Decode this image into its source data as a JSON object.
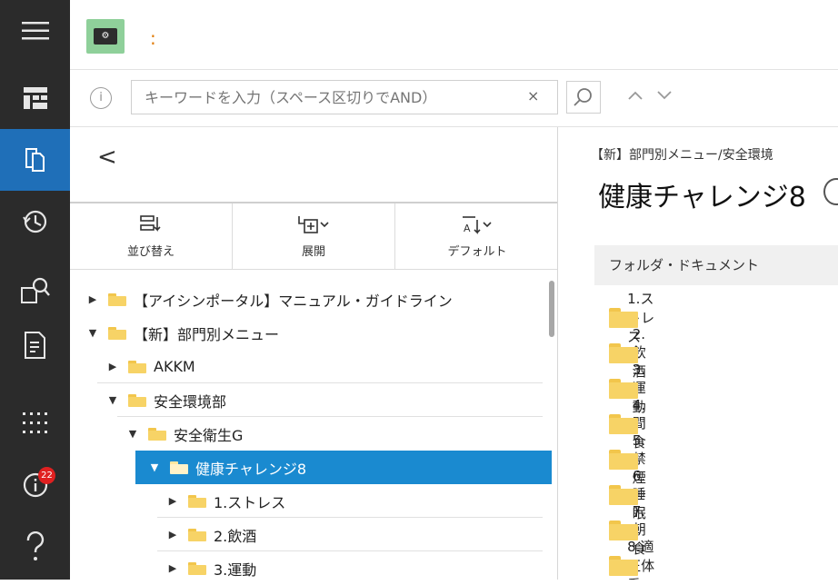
{
  "app": {
    "title": ":",
    "icon_label": "⚙"
  },
  "sidebar": {
    "items": [
      {
        "name": "menu-icon"
      },
      {
        "name": "dashboard-icon"
      },
      {
        "name": "documents-icon",
        "active": true
      },
      {
        "name": "history-icon"
      },
      {
        "name": "search-folder-icon"
      },
      {
        "name": "edit-document-icon"
      },
      {
        "name": "apps-grid-icon"
      },
      {
        "name": "info-icon",
        "badge": "22"
      },
      {
        "name": "help-icon"
      }
    ]
  },
  "search": {
    "placeholder": "キーワードを入力（スペース区切りでAND）",
    "clear_label": "×",
    "prev_label": "∧",
    "next_label": "∨",
    "info_label": "i"
  },
  "tree_panel": {
    "back_label": "<",
    "toolbar": [
      {
        "label": "並び替え"
      },
      {
        "label": "展開"
      },
      {
        "label": "デフォルト"
      }
    ],
    "rows": [
      {
        "label": "【アイシンポータル】マニュアル・ガイドライン",
        "caret": "▶",
        "level": 0
      },
      {
        "label": "【新】部門別メニュー",
        "caret": "▼",
        "level": 0
      },
      {
        "label": "AKKM",
        "caret": "▶",
        "level": 1
      },
      {
        "label": "安全環境部",
        "caret": "▼",
        "level": 1
      },
      {
        "label": "安全衛生G",
        "caret": "▼",
        "level": 2
      },
      {
        "label": "健康チャレンジ8",
        "caret": "▼",
        "level": 3,
        "selected": true
      },
      {
        "label": "1.ストレス",
        "caret": "▶",
        "level": 4
      },
      {
        "label": "2.飲酒",
        "caret": "▶",
        "level": 4
      },
      {
        "label": "3.運動",
        "caret": "▶",
        "level": 4
      }
    ]
  },
  "right_pane": {
    "breadcrumb": "【新】部門別メニュー/安全環境",
    "title": "健康チャレンジ8",
    "list_header": "フォルダ・ドキュメント",
    "items": [
      "1.ストレス",
      "2.飲酒",
      "3.運動",
      "4.間食",
      "5.禁煙",
      "6.睡眠",
      "7.朝食",
      "8.適正体重"
    ]
  },
  "colors": {
    "rail_bg": "#2b2b2b",
    "accent_active": "#1f6fb8",
    "selected_row": "#1a8ad0",
    "folder": "#f7d366",
    "badge": "#e02020"
  }
}
